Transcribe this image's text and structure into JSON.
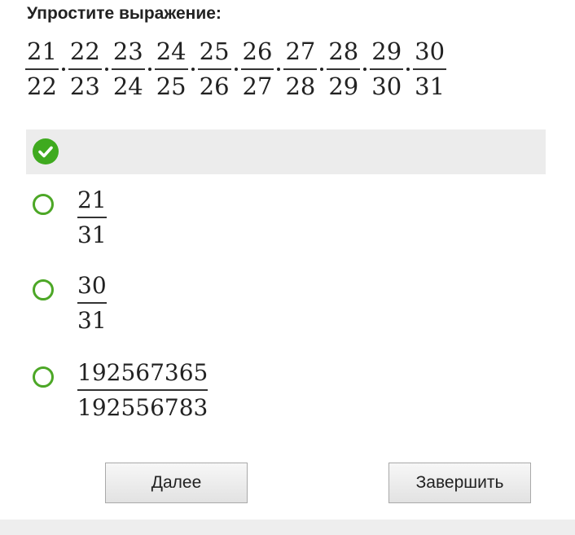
{
  "question": {
    "title": "Упростите выражение:",
    "expression": [
      {
        "num": "21",
        "den": "22"
      },
      {
        "num": "22",
        "den": "23"
      },
      {
        "num": "23",
        "den": "24"
      },
      {
        "num": "24",
        "den": "25"
      },
      {
        "num": "25",
        "den": "26"
      },
      {
        "num": "26",
        "den": "27"
      },
      {
        "num": "27",
        "den": "28"
      },
      {
        "num": "28",
        "den": "29"
      },
      {
        "num": "29",
        "den": "30"
      },
      {
        "num": "30",
        "den": "31"
      }
    ]
  },
  "answer_bar": {
    "status_icon": "check-circle-icon",
    "status_color": "#3faa1f"
  },
  "options": [
    {
      "num": "21",
      "den": "31",
      "selected": false
    },
    {
      "num": "30",
      "den": "31",
      "selected": false
    },
    {
      "num": "192567365",
      "den": "192556783",
      "selected": false
    }
  ],
  "buttons": {
    "next_label": "Далее",
    "finish_label": "Завершить"
  },
  "colors": {
    "radio_border": "#4ca726",
    "answer_bar_bg": "#ececec"
  }
}
